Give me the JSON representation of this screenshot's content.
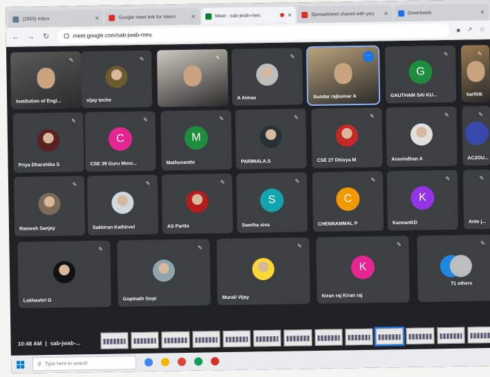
{
  "browser": {
    "tabs": [
      {
        "label": "(2650) Inbox",
        "favicon_color": "#607d8b",
        "active": false
      },
      {
        "label": "Google meet link for Intern",
        "favicon_color": "#d93025",
        "active": false
      },
      {
        "label": "Meet - sab-jwab-meu",
        "favicon_color": "#00832d",
        "active": true
      },
      {
        "label": "Spreadsheet shared with you",
        "favicon_color": "#d93025",
        "active": false
      },
      {
        "label": "Downloads",
        "favicon_color": "#1a73e8",
        "active": false
      }
    ],
    "url": "meet.google.com/sab-jwab-meu"
  },
  "participants": [
    {
      "name": "Institution of Engi...",
      "kind": "video",
      "scene": "#5a5a5a"
    },
    {
      "name": "vijay teche",
      "kind": "photo",
      "color": "#6d5a2e"
    },
    {
      "name": "",
      "kind": "video",
      "scene": "#cfcac0"
    },
    {
      "name": "A Aimas",
      "kind": "photo",
      "color": "#bdbdbd"
    },
    {
      "name": "Sundar rajkumar A",
      "kind": "video",
      "scene": "#b9a27a"
    },
    {
      "name": "GAUTHAM SAI KU...",
      "kind": "initial",
      "initial": "G",
      "color": "#1e8e3e"
    },
    {
      "name": "karthik",
      "kind": "video",
      "scene": "#9a7a50"
    },
    {
      "name": "Priya Dharshika S",
      "kind": "photo",
      "color": "#5b1f1f"
    },
    {
      "name": "CSE 39 Guru Moor...",
      "kind": "initial",
      "initial": "C",
      "color": "#e52592"
    },
    {
      "name": "Mathuvanthi",
      "kind": "initial",
      "initial": "M",
      "color": "#1e8e3e"
    },
    {
      "name": "PARIMALA.S",
      "kind": "photo",
      "color": "#263238"
    },
    {
      "name": "CSE 27 Dhivya M",
      "kind": "photo",
      "color": "#c62828"
    },
    {
      "name": "Aravindhan A",
      "kind": "photo",
      "color": "#e0e0e0"
    },
    {
      "name": "AC2OU...",
      "kind": "initial",
      "initial": "",
      "color": "#3949ab"
    },
    {
      "name": "Ramesh Sanjay",
      "kind": "photo",
      "color": "#7b6b58"
    },
    {
      "name": "Sakkiran Kathirvel",
      "kind": "photo",
      "color": "#cfd8dc"
    },
    {
      "name": "AS Parthi",
      "kind": "photo",
      "color": "#b71c1c"
    },
    {
      "name": "Swetha siva",
      "kind": "initial",
      "initial": "S",
      "color": "#12a4af"
    },
    {
      "name": "CHENNAMMAL P",
      "kind": "initial",
      "initial": "C",
      "color": "#f29900"
    },
    {
      "name": "KannanKD",
      "kind": "initial",
      "initial": "K",
      "color": "#9334e6"
    },
    {
      "name": "Ante j...",
      "kind": "initial",
      "initial": "",
      "color": "#3c4043"
    },
    {
      "name": "Lokhashri G",
      "kind": "photo",
      "color": "#111111"
    },
    {
      "name": "Gopinath Gopi",
      "kind": "photo",
      "color": "#90a4ae"
    },
    {
      "name": "Murali Vijay",
      "kind": "photo",
      "color": "#fdd835"
    },
    {
      "name": "Kiran raj Kiran raj",
      "kind": "initial",
      "initial": "K",
      "color": "#e52592"
    },
    {
      "name": "71 others",
      "kind": "others",
      "color": "#1e88e5"
    }
  ],
  "meeting": {
    "time": "10:48 AM",
    "separator": "|",
    "code": "sab-jwab-..."
  },
  "taskbar": {
    "search_placeholder": "Type here to search"
  }
}
